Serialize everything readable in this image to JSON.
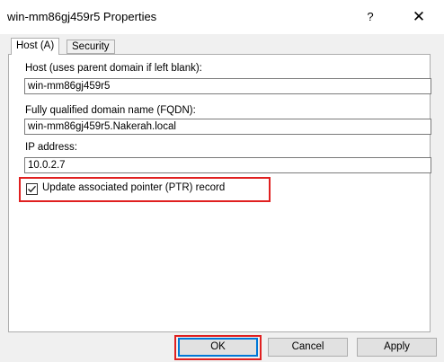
{
  "window": {
    "title": "win-mm86gj459r5 Properties",
    "help_glyph": "?",
    "close_glyph": "✕"
  },
  "tabs": [
    {
      "label": "Host (A)",
      "active": true
    },
    {
      "label": "Security",
      "active": false
    }
  ],
  "host": {
    "label": "Host (uses parent domain if left blank):",
    "value": "win-mm86gj459r5"
  },
  "fqdn": {
    "label": "Fully qualified domain name (FQDN):",
    "value": "win-mm86gj459r5.Nakerah.local"
  },
  "ip": {
    "label": "IP address:",
    "value": "10.0.2.7"
  },
  "ptr": {
    "label": "Update associated pointer (PTR) record",
    "checked": true
  },
  "buttons": {
    "ok": "OK",
    "cancel": "Cancel",
    "apply": "Apply"
  },
  "colors": {
    "highlight": "#e02020",
    "focus": "#0078d7"
  }
}
